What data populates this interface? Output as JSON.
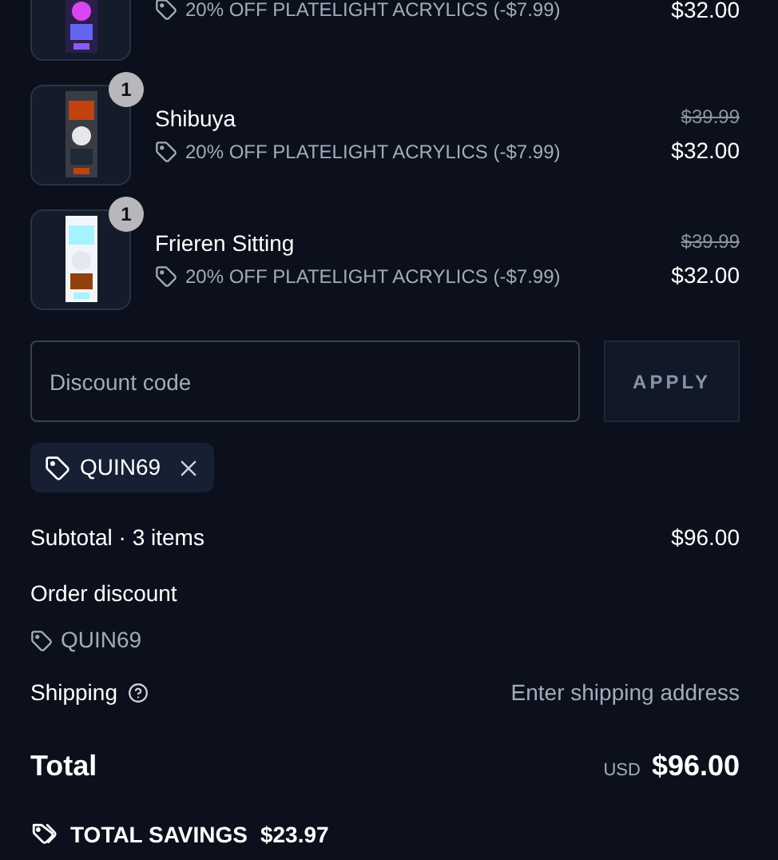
{
  "items": [
    {
      "discount": "20% OFF PLATELIGHT ACRYLICS (-$7.99)",
      "price": "$32.00"
    },
    {
      "quantity": "1",
      "name": "Shibuya",
      "discount": "20% OFF PLATELIGHT ACRYLICS (-$7.99)",
      "compare_price": "$39.99",
      "price": "$32.00"
    },
    {
      "quantity": "1",
      "name": "Frieren Sitting",
      "discount": "20% OFF PLATELIGHT ACRYLICS (-$7.99)",
      "compare_price": "$39.99",
      "price": "$32.00"
    }
  ],
  "discount_field": {
    "placeholder": "Discount code"
  },
  "apply_button": "APPLY",
  "applied_codes": [
    {
      "code": "QUIN69"
    }
  ],
  "summary": {
    "subtotal_label": "Subtotal · 3 items",
    "subtotal": "$96.00",
    "order_discount_label": "Order discount",
    "order_discount_code": "QUIN69",
    "shipping_label": "Shipping",
    "shipping_value": "Enter shipping address",
    "total_label": "Total",
    "currency": "USD",
    "total": "$96.00",
    "savings_label": "TOTAL SAVINGS",
    "savings": "$23.97"
  }
}
